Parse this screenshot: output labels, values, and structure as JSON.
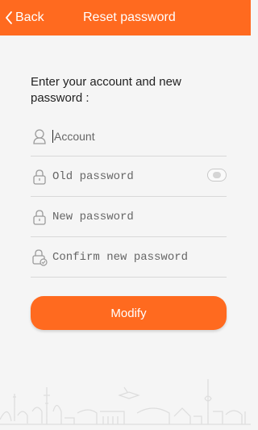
{
  "header": {
    "back_label": "Back",
    "title": "Reset password"
  },
  "instruction": "Enter your account and new password :",
  "fields": [
    {
      "name": "account",
      "placeholder": "Account",
      "icon": "user-icon"
    },
    {
      "name": "old_password",
      "placeholder": "Old password",
      "icon": "lock-icon",
      "toggle": "show-password-toggle"
    },
    {
      "name": "new_password",
      "placeholder": "New password",
      "icon": "lock-icon"
    },
    {
      "name": "confirm_password",
      "placeholder": "Confirm new password",
      "icon": "lock-check-icon"
    }
  ],
  "modify_label": "Modify",
  "colors": {
    "accent": "#ff6a1f",
    "background": "#f5f5f5",
    "divider": "#d8d8d8"
  }
}
